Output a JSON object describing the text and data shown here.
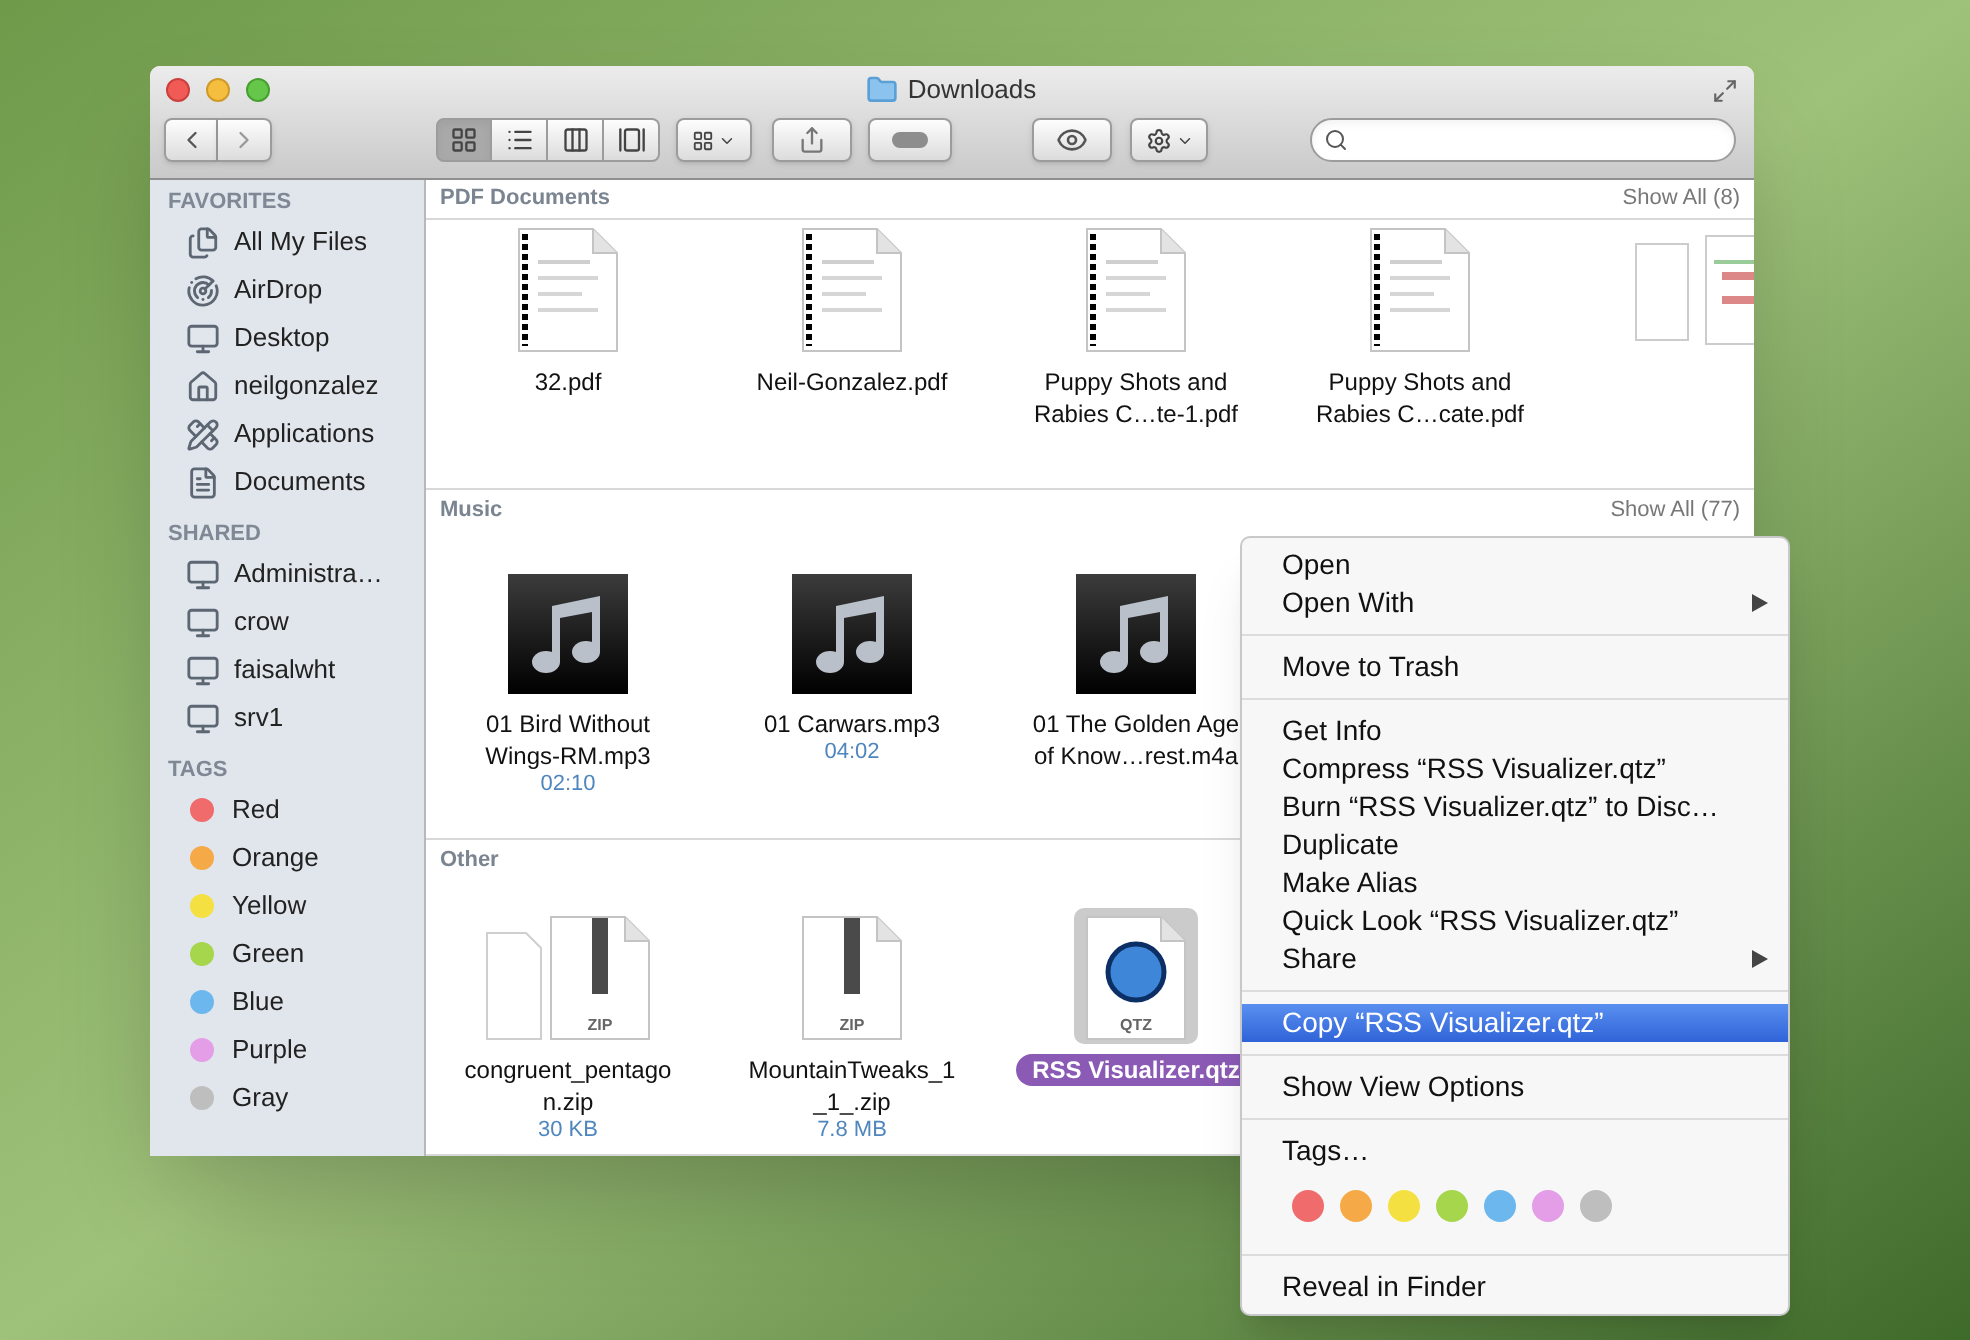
{
  "window": {
    "title": "Downloads"
  },
  "toolbar": {
    "view_modes": [
      {
        "kind": "icons",
        "selected": true
      },
      {
        "kind": "list",
        "selected": false
      },
      {
        "kind": "columns",
        "selected": false
      },
      {
        "kind": "coverflow",
        "selected": false
      }
    ]
  },
  "sidebar": {
    "sections": [
      {
        "title": "FAVORITES",
        "items": [
          {
            "label": "All My Files"
          },
          {
            "label": "AirDrop"
          },
          {
            "label": "Desktop"
          },
          {
            "label": "neilgonzalez"
          },
          {
            "label": "Applications"
          },
          {
            "label": "Documents"
          }
        ]
      },
      {
        "title": "SHARED",
        "items": [
          {
            "label": "Administra…"
          },
          {
            "label": "crow"
          },
          {
            "label": "faisalwht"
          },
          {
            "label": "srv1"
          }
        ]
      },
      {
        "title": "TAGS",
        "items": [
          {
            "label": "Red",
            "color": "#f06b6b"
          },
          {
            "label": "Orange",
            "color": "#f6aa47"
          },
          {
            "label": "Yellow",
            "color": "#f4e141"
          },
          {
            "label": "Green",
            "color": "#a5d64c"
          },
          {
            "label": "Blue",
            "color": "#6cb8ee"
          },
          {
            "label": "Purple",
            "color": "#e49de7"
          },
          {
            "label": "Gray",
            "color": "#bebebe"
          }
        ]
      }
    ]
  },
  "sections": [
    {
      "title": "PDF Documents",
      "show_all": "Show All (8)",
      "items": [
        {
          "kind": "pdf",
          "name_lines": [
            "32.pdf"
          ],
          "selected": false
        },
        {
          "kind": "pdf",
          "name_lines": [
            "Neil-Gonzalez.pdf"
          ],
          "selected": false
        },
        {
          "kind": "pdf",
          "name_lines": [
            "Puppy Shots and",
            "Rabies C…te-1.pdf"
          ],
          "selected": false
        },
        {
          "kind": "pdf",
          "name_lines": [
            "Puppy Shots and",
            "Rabies C…cate.pdf"
          ],
          "selected": false
        },
        {
          "kind": "pdf_pair",
          "selected": false
        }
      ]
    },
    {
      "title": "Music",
      "show_all": "Show All (77)",
      "items": [
        {
          "kind": "audio",
          "name_lines": [
            "01 Bird Without",
            "Wings-RM.mp3"
          ],
          "detail": "02:10",
          "selected": false
        },
        {
          "kind": "audio",
          "name_lines": [
            "01 Carwars.mp3"
          ],
          "detail": "04:02",
          "selected": false
        },
        {
          "kind": "audio",
          "name_lines": [
            "01 The Golden Age",
            "of Know…rest.m4a"
          ],
          "selected": false
        }
      ]
    },
    {
      "title": "Other",
      "items": [
        {
          "kind": "archive",
          "type_label": "ZIP",
          "stacked": true,
          "name_lines": [
            "congruent_pentago",
            "n.zip"
          ],
          "detail": "30 KB",
          "selected": false
        },
        {
          "kind": "archive",
          "type_label": "ZIP",
          "stacked": false,
          "name_lines": [
            "MountainTweaks_1",
            "_1_.zip"
          ],
          "detail": "7.8 MB",
          "selected": false
        },
        {
          "kind": "composition",
          "type_label": "QTZ",
          "name_lines": [
            "RSS Visualizer.qtz"
          ],
          "selected": true
        }
      ]
    }
  ],
  "context_menu": {
    "groups": [
      {
        "items": [
          {
            "label": "Open",
            "submenu": false,
            "highlighted": false
          },
          {
            "label": "Open With",
            "submenu": true,
            "highlighted": false
          }
        ]
      },
      {
        "items": [
          {
            "label": "Move to Trash",
            "submenu": false,
            "highlighted": false
          }
        ]
      },
      {
        "items": [
          {
            "label": "Get Info",
            "submenu": false,
            "highlighted": false
          },
          {
            "label": "Compress “RSS Visualizer.qtz”",
            "submenu": false,
            "highlighted": false
          },
          {
            "label": "Burn “RSS Visualizer.qtz” to Disc…",
            "submenu": false,
            "highlighted": false
          },
          {
            "label": "Duplicate",
            "submenu": false,
            "highlighted": false
          },
          {
            "label": "Make Alias",
            "submenu": false,
            "highlighted": false
          },
          {
            "label": "Quick Look “RSS Visualizer.qtz”",
            "submenu": false,
            "highlighted": false
          },
          {
            "label": "Share",
            "submenu": true,
            "highlighted": false
          }
        ]
      },
      {
        "items": [
          {
            "label": "Copy “RSS Visualizer.qtz”",
            "submenu": false,
            "highlighted": true
          }
        ]
      },
      {
        "items": [
          {
            "label": "Show View Options",
            "submenu": false,
            "highlighted": false
          }
        ]
      },
      {
        "items": [
          {
            "label": "Tags…",
            "submenu": false,
            "highlighted": false
          }
        ],
        "tag_colors": [
          {
            "color": "#f06b6b"
          },
          {
            "color": "#f6aa47"
          },
          {
            "color": "#f4e141"
          },
          {
            "color": "#a5d64c"
          },
          {
            "color": "#6cb8ee"
          },
          {
            "color": "#e49de7"
          },
          {
            "color": "#bebebe"
          }
        ]
      },
      {
        "items": [
          {
            "label": "Reveal in Finder",
            "submenu": false,
            "highlighted": false
          }
        ]
      }
    ]
  }
}
